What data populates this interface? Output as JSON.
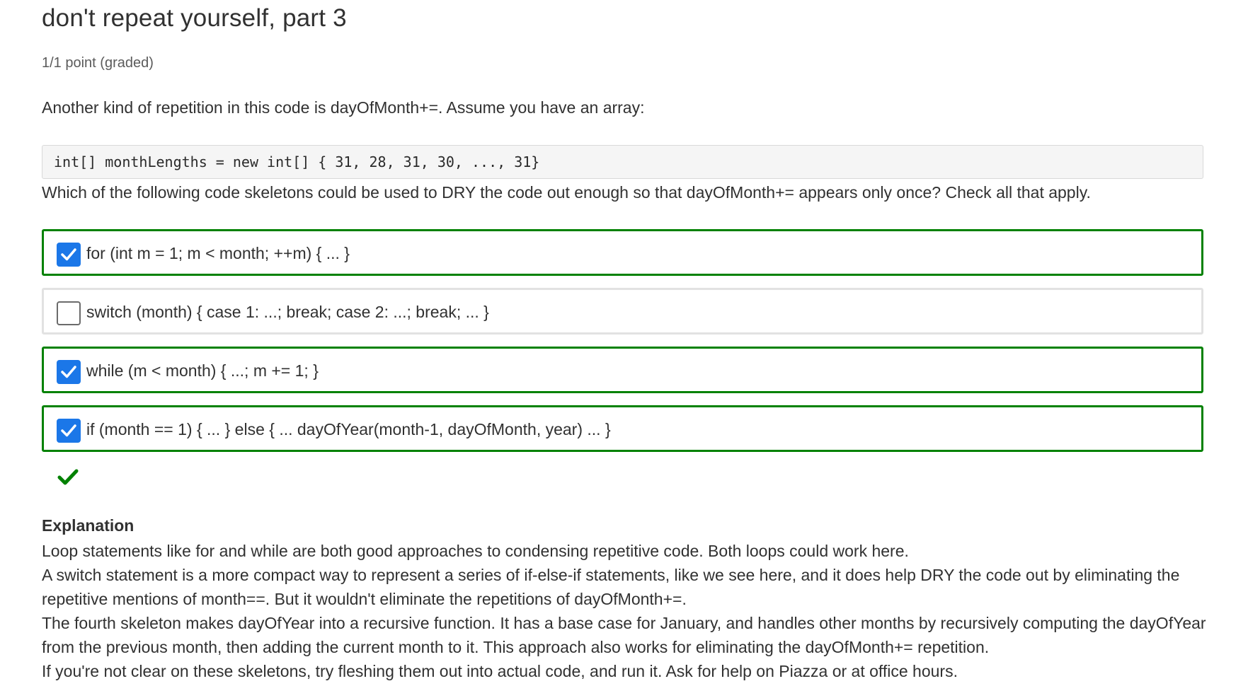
{
  "problem": {
    "title": "don't repeat yourself, part 3",
    "points": "1/1 point (graded)",
    "prompt": "Another kind of repetition in this code is dayOfMonth+=. Assume you have an array:",
    "code": "int[] monthLengths = new int[] { 31, 28, 31, 30, ..., 31}",
    "question": "Which of the following code skeletons could be used to DRY the code out enough so that dayOfMonth+= appears only once? Check all that apply."
  },
  "choices": [
    {
      "label": "for (int m = 1; m < month; ++m) { ... }",
      "checked": true,
      "correct": true
    },
    {
      "label": "switch (month) { case 1: ...; break; case 2: ...; break; ... }",
      "checked": false,
      "correct": false
    },
    {
      "label": "while (m < month) { ...; m += 1; }",
      "checked": true,
      "correct": true
    },
    {
      "label": "if (month == 1) { ... } else { ... dayOfYear(month-1, dayOfMonth, year) ... }",
      "checked": true,
      "correct": true
    }
  ],
  "result": {
    "icon": "checkmark-icon",
    "color": "#008100"
  },
  "explanation": {
    "heading": "Explanation",
    "lines": [
      "Loop statements like for and while are both good approaches to condensing repetitive code. Both loops could work here.",
      "A switch statement is a more compact way to represent a series of if-else-if statements, like we see here, and it does help DRY the code out by eliminating the",
      "repetitive mentions of month==. But it wouldn't eliminate the repetitions of dayOfMonth+=.",
      "The fourth skeleton makes dayOfYear into a recursive function. It has a base case for January, and handles other months by recursively computing the dayOfYear",
      "from the previous month, then adding the current month to it. This approach also works for eliminating the dayOfMonth+= repetition.",
      "If you're not clear on these skeletons, try fleshing them out into actual code, and run it. Ask for help on Piazza or at office hours."
    ]
  },
  "colors": {
    "checkbox_checked": "#1b77e8",
    "correct_border": "#008100",
    "unselected_border": "#e2e2e2"
  }
}
